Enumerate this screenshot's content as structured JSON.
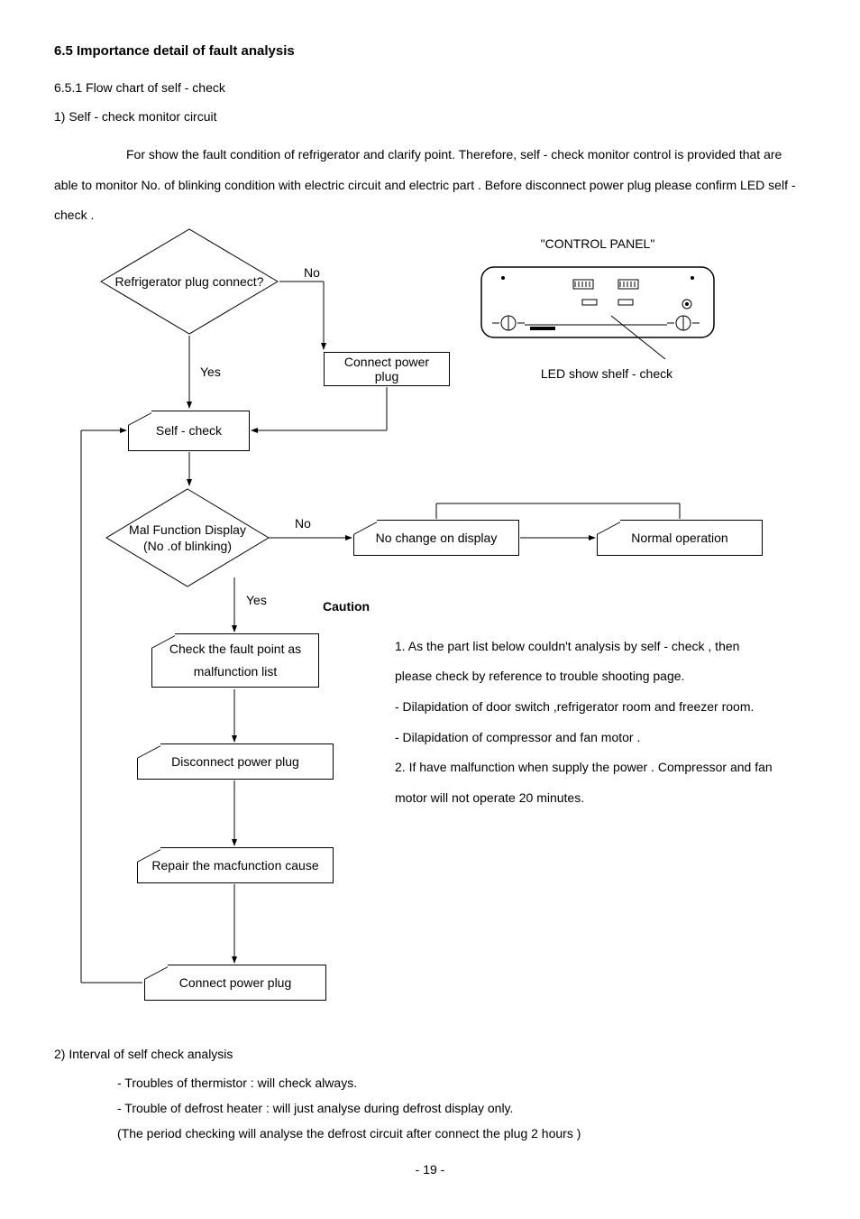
{
  "section": {
    "title": "6.5  Importance detail of fault analysis",
    "sub1": "6.5.1 Flow chart of self - check",
    "sub2_1": "1) Self - check monitor circuit",
    "para": "For show the fault condition of refrigerator and clarify point. Therefore, self - check monitor control is provided that are able to monitor No. of blinking condition with electric circuit and electric part . Before disconnect power plug please confirm LED self - check ."
  },
  "flow": {
    "d1": "Refrigerator plug connect?",
    "d1_no": "No",
    "d1_yes": "Yes",
    "b_connect": "Connect power plug",
    "b_self": "Self - check",
    "d2_l1": "Mal Function Display",
    "d2_l2": "(No .of blinking)",
    "d2_no": "No",
    "d2_yes": "Yes",
    "b_nochange": "No change on display",
    "b_normal": "Normal operation",
    "b_check": "Check the fault point as malfunction list",
    "b_disc": "Disconnect power plug",
    "b_repair": "Repair the macfunction cause",
    "b_conn2": "Connect power plug"
  },
  "panel": {
    "title": "\"CONTROL PANEL\"",
    "caption": "LED show shelf - check"
  },
  "caution": {
    "title": "Caution",
    "l1": "1. As the part list below couldn't analysis by  self - check , then please check by reference to trouble shooting page.",
    "l2": "- Dilapidation of door switch ,refrigerator room and freezer room.",
    "l3": "- Dilapidation of compressor and fan motor .",
    "l4": "2. If have malfunction when supply the power . Compressor and fan motor will not operate 20 minutes."
  },
  "sec2": {
    "title": "2) Interval of self check analysis",
    "b1": "- Troubles of thermistor : will check always.",
    "b2": "- Trouble of defrost heater : will just analyse during defrost display only.",
    "b3": "(The period checking will analyse the defrost circuit after connect the plug 2 hours  )"
  },
  "pagenum": "- 19 -"
}
